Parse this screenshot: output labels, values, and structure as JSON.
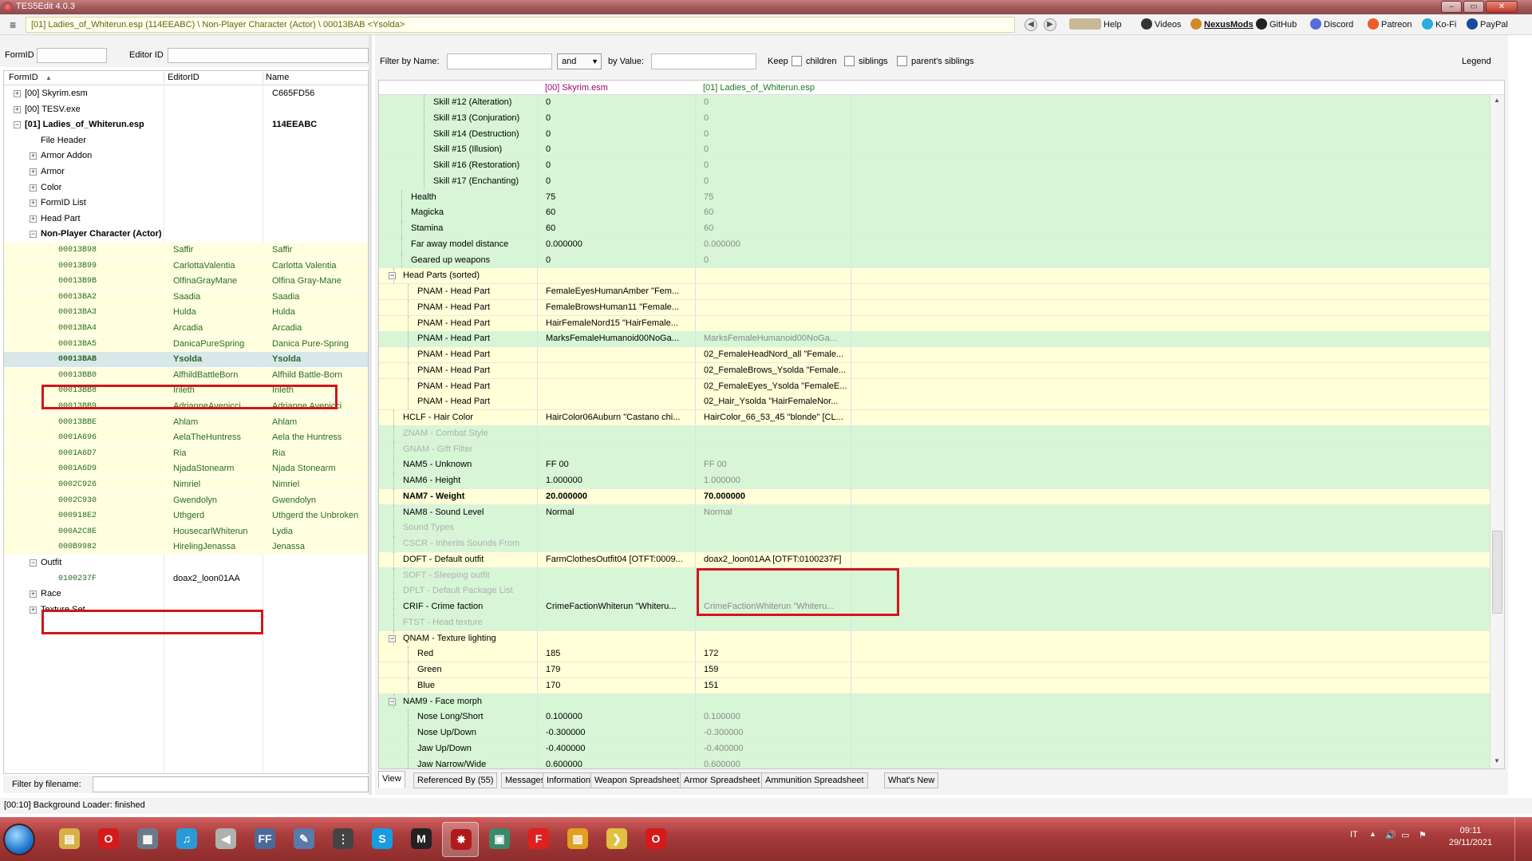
{
  "window": {
    "title": "TES5Edit 4.0.3",
    "min": "‒",
    "max": "▭",
    "close": "✕"
  },
  "toolbar": {
    "path": "[01] Ladies_of_Whiterun.esp (114EEABC) \\ Non-Player Character (Actor) \\ 00013BAB <Ysolda>",
    "back": "◀",
    "forward": "▶",
    "links": [
      {
        "label": "Help",
        "icon": "book-icon"
      },
      {
        "label": "Videos",
        "icon": "video-icon"
      },
      {
        "label": "NexusMods",
        "icon": "nexusmods-icon"
      },
      {
        "label": "GitHub",
        "icon": "github-icon"
      },
      {
        "label": "Discord",
        "icon": "discord-icon"
      },
      {
        "label": "Patreon",
        "icon": "patreon-icon"
      },
      {
        "label": "Ko-Fi",
        "icon": "kofi-icon"
      },
      {
        "label": "PayPal",
        "icon": "paypal-icon"
      }
    ]
  },
  "left": {
    "formid_label": "FormID",
    "editorid_label": "Editor ID",
    "columns": [
      "FormID",
      "EditorID",
      "Name"
    ],
    "sort_arrow": "▲",
    "filename_label": "Filter by filename:",
    "rows": [
      {
        "exp": "+",
        "c1": "[00] Skyrim.esm",
        "c3": "C665FD56"
      },
      {
        "exp": "+",
        "c1": "[00] TESV.exe"
      },
      {
        "exp": "−",
        "c1": "[01] Ladies_of_Whiterun.esp",
        "c3": "114EEABC"
      },
      {
        "c1": "File Header"
      },
      {
        "exp": "+",
        "c1": "Armor Addon"
      },
      {
        "exp": "+",
        "c1": "Armor"
      },
      {
        "exp": "+",
        "c1": "Color"
      },
      {
        "exp": "+",
        "c1": "FormID List"
      },
      {
        "exp": "+",
        "c1": "Head Part"
      },
      {
        "exp": "−",
        "c1": "Non-Player Character (Actor)"
      },
      {
        "c1": "00013B98",
        "c2": "Saffir",
        "c3": "Saffir"
      },
      {
        "c1": "00013B99",
        "c2": "CarlottaValentia",
        "c3": "Carlotta Valentia"
      },
      {
        "c1": "00013B9B",
        "c2": "OlfinaGrayMane",
        "c3": "Olfina Gray-Mane"
      },
      {
        "c1": "00013BA2",
        "c2": "Saadia",
        "c3": "Saadia"
      },
      {
        "c1": "00013BA3",
        "c2": "Hulda",
        "c3": "Hulda"
      },
      {
        "c1": "00013BA4",
        "c2": "Arcadia",
        "c3": "Arcadia"
      },
      {
        "c1": "00013BA5",
        "c2": "DanicaPureSpring",
        "c3": "Danica Pure-Spring"
      },
      {
        "c1": "00013BAB",
        "c2": "Ysolda",
        "c3": "Ysolda"
      },
      {
        "c1": "00013BB0",
        "c2": "AlfhildBattleBorn",
        "c3": "Alfhild Battle-Born"
      },
      {
        "c1": "00013BB8",
        "c2": "Irileth",
        "c3": "Irileth"
      },
      {
        "c1": "00013BB9",
        "c2": "AdrianneAvenicci",
        "c3": "Adrianne Avenicci"
      },
      {
        "c1": "00013BBE",
        "c2": "Ahlam",
        "c3": "Ahlam"
      },
      {
        "c1": "0001A696",
        "c2": "AelaTheHuntress",
        "c3": "Aela the Huntress"
      },
      {
        "c1": "0001A6D7",
        "c2": "Ria",
        "c3": "Ria"
      },
      {
        "c1": "0001A6D9",
        "c2": "NjadaStonearm",
        "c3": "Njada Stonearm"
      },
      {
        "c1": "0002C926",
        "c2": "Nimriel",
        "c3": "Nimriel"
      },
      {
        "c1": "0002C930",
        "c2": "Gwendolyn",
        "c3": "Gwendolyn"
      },
      {
        "c1": "000918E2",
        "c2": "Uthgerd",
        "c3": "Uthgerd the Unbroken"
      },
      {
        "c1": "000A2C8E",
        "c2": "HousecarlWhiterun",
        "c3": "Lydia"
      },
      {
        "c1": "000B9982",
        "c2": "HirelingJenassa",
        "c3": "Jenassa"
      },
      {
        "exp": "−",
        "c1": "Outfit"
      },
      {
        "c1": "0100237F",
        "c2": "doax2_loon01AA"
      },
      {
        "exp": "+",
        "c1": "Race"
      },
      {
        "exp": "+",
        "c1": "Texture Set"
      }
    ]
  },
  "right": {
    "filter_name_label": "Filter by Name:",
    "and_value": "and",
    "filter_value_label": "by Value:",
    "keep_label": "Keep",
    "children_label": "children",
    "siblings_label": "siblings",
    "parents_siblings_label": "parent's siblings",
    "legend_label": "Legend",
    "col1_header": "[00] Skyrim.esm",
    "col2_header": "[01] Ladies_of_Whiterun.esp",
    "rows": [
      {
        "k": "Skill #12 (Alteration)",
        "v1": "0",
        "v2": "0"
      },
      {
        "k": "Skill #13 (Conjuration)",
        "v1": "0",
        "v2": "0"
      },
      {
        "k": "Skill #14 (Destruction)",
        "v1": "0",
        "v2": "0"
      },
      {
        "k": "Skill #15 (Illusion)",
        "v1": "0",
        "v2": "0"
      },
      {
        "k": "Skill #16 (Restoration)",
        "v1": "0",
        "v2": "0"
      },
      {
        "k": "Skill #17 (Enchanting)",
        "v1": "0",
        "v2": "0"
      },
      {
        "k": "Health",
        "v1": "75",
        "v2": "75"
      },
      {
        "k": "Magicka",
        "v1": "60",
        "v2": "60"
      },
      {
        "k": "Stamina",
        "v1": "60",
        "v2": "60"
      },
      {
        "k": "Far away model distance",
        "v1": "0.000000",
        "v2": "0.000000"
      },
      {
        "k": "Geared up weapons",
        "v1": "0",
        "v2": "0"
      },
      {
        "exp": "−",
        "k": "Head Parts (sorted)",
        "v1": "",
        "v2": ""
      },
      {
        "k": "PNAM - Head Part",
        "v1": "FemaleEyesHumanAmber \"Fem...",
        "v2": ""
      },
      {
        "k": "PNAM - Head Part",
        "v1": "FemaleBrowsHuman11 \"Female...",
        "v2": ""
      },
      {
        "k": "PNAM - Head Part",
        "v1": "HairFemaleNord15 \"HairFemale...",
        "v2": ""
      },
      {
        "k": "PNAM - Head Part",
        "v1": "MarksFemaleHumanoid00NoGa...",
        "v2": "MarksFemaleHumanoid00NoGa..."
      },
      {
        "k": "PNAM - Head Part",
        "v1": "",
        "v2": "02_FemaleHeadNord_all \"Female..."
      },
      {
        "k": "PNAM - Head Part",
        "v1": "",
        "v2": "02_FemaleBrows_Ysolda \"Female..."
      },
      {
        "k": "PNAM - Head Part",
        "v1": "",
        "v2": "02_FemaleEyes_Ysolda \"FemaleE..."
      },
      {
        "k": "PNAM - Head Part",
        "v1": "",
        "v2": "02_Hair_Ysolda \"HairFemaleNor..."
      },
      {
        "k": "HCLF - Hair Color",
        "v1": "HairColor06Auburn \"Castano chi...",
        "v2": "HairColor_66_53_45 \"blonde\" [CL..."
      },
      {
        "k": "ZNAM - Combat Style",
        "v1": "",
        "v2": ""
      },
      {
        "k": "GNAM - Gift Filter",
        "v1": "",
        "v2": ""
      },
      {
        "k": "NAM5 - Unknown",
        "v1": "FF 00",
        "v2": "FF 00"
      },
      {
        "k": "NAM6 - Height",
        "v1": "1.000000",
        "v2": "1.000000"
      },
      {
        "k": "NAM7 - Weight",
        "v1": "20.000000",
        "v2": "70.000000"
      },
      {
        "k": "NAM8 - Sound Level",
        "v1": "Normal",
        "v2": "Normal"
      },
      {
        "k": "Sound Types",
        "v1": "",
        "v2": ""
      },
      {
        "k": "CSCR - Inherits Sounds From",
        "v1": "",
        "v2": ""
      },
      {
        "k": "DOFT - Default outfit",
        "v1": "FarmClothesOutfit04 [OTFT:0009...",
        "v2": "doax2_loon01AA [OTFT:0100237F]"
      },
      {
        "k": "SOFT - Sleeping outfit",
        "v1": "",
        "v2": ""
      },
      {
        "k": "DPLT - Default Package List",
        "v1": "",
        "v2": ""
      },
      {
        "k": "CRIF - Crime faction",
        "v1": "CrimeFactionWhiterun \"Whiteru...",
        "v2": "CrimeFactionWhiterun \"Whiteru..."
      },
      {
        "k": "FTST - Head texture",
        "v1": "",
        "v2": ""
      },
      {
        "exp": "−",
        "k": "QNAM - Texture lighting",
        "v1": "",
        "v2": ""
      },
      {
        "k": "Red",
        "v1": "185",
        "v2": "172"
      },
      {
        "k": "Green",
        "v1": "179",
        "v2": "159"
      },
      {
        "k": "Blue",
        "v1": "170",
        "v2": "151"
      },
      {
        "exp": "−",
        "k": "NAM9 - Face morph",
        "v1": "",
        "v2": ""
      },
      {
        "k": "Nose Long/Short",
        "v1": "0.100000",
        "v2": "0.100000"
      },
      {
        "k": "Nose Up/Down",
        "v1": "-0.300000",
        "v2": "-0.300000"
      },
      {
        "k": "Jaw Up/Down",
        "v1": "-0.400000",
        "v2": "-0.400000"
      },
      {
        "k": "Jaw Narrow/Wide",
        "v1": "0.600000",
        "v2": "0.600000"
      }
    ],
    "tabs": [
      "View",
      "Referenced By (55)",
      "Messages",
      "Information",
      "Weapon Spreadsheet",
      "Armor Spreadsheet",
      "Ammunition Spreadsheet",
      "What's New"
    ]
  },
  "status": {
    "text": "[00:10] Background Loader: finished"
  },
  "taskbar": {
    "language": "IT",
    "time": "09:11",
    "date": "29/11/2021",
    "apps": [
      {
        "icon": "folder-icon",
        "glyph": "▤",
        "color": "#d8b048"
      },
      {
        "icon": "opera-icon",
        "glyph": "O",
        "color": "#d41a1a"
      },
      {
        "icon": "media-icon",
        "glyph": "▦",
        "color": "#6a7a8a"
      },
      {
        "icon": "music-icon",
        "glyph": "♫",
        "color": "#2a9ad6"
      },
      {
        "icon": "speaker-icon",
        "glyph": "◀",
        "color": "#b0b0b0"
      },
      {
        "icon": "ffdec-icon",
        "glyph": "FF",
        "color": "#4a6a9a"
      },
      {
        "icon": "pen-icon",
        "glyph": "✎",
        "color": "#5a7aa8"
      },
      {
        "icon": "equalizer-icon",
        "glyph": "⋮",
        "color": "#444444"
      },
      {
        "icon": "skype-icon",
        "glyph": "S",
        "color": "#1a9ae0"
      },
      {
        "icon": "mmm-icon",
        "glyph": "M",
        "color": "#222222"
      },
      {
        "icon": "tes5edit-icon",
        "glyph": "✸",
        "color": "#b01a1a"
      },
      {
        "icon": "window-icon",
        "glyph": "▣",
        "color": "#3a8a6a"
      },
      {
        "icon": "f-app-icon",
        "glyph": "F",
        "color": "#e02020"
      },
      {
        "icon": "chart-app-icon",
        "glyph": "▥",
        "color": "#e0a020"
      },
      {
        "icon": "arrow-app-icon",
        "glyph": "❯",
        "color": "#e0c040"
      },
      {
        "icon": "opera-active-icon",
        "glyph": "O",
        "color": "#d41a1a"
      }
    ]
  }
}
